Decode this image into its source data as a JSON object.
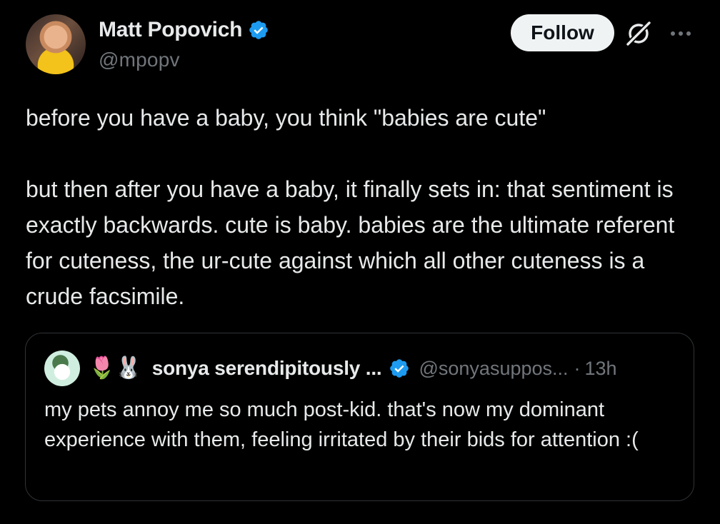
{
  "author": {
    "display_name": "Matt Popovich",
    "handle": "@mpopv",
    "verified": true
  },
  "actions": {
    "follow_label": "Follow"
  },
  "tweet": {
    "paragraph_1": "before you have a baby, you think \"babies are cute\"",
    "paragraph_2": "but then after you have a baby, it finally sets in: that sentiment is exactly backwards. cute is baby. babies are the ultimate referent for cuteness, the ur-cute against which all other cuteness is a crude facsimile."
  },
  "quoted_tweet": {
    "emojis": "🌷🐰",
    "display_name": "sonya serendipitously ...",
    "handle": "@sonyasuppos...",
    "separator": "·",
    "time": "13h",
    "verified": true,
    "text": "my pets annoy me so much post-kid. that's now my dominant experience with them, feeling irritated by their bids for attention :("
  },
  "colors": {
    "background": "#000000",
    "text_primary": "#e7e9ea",
    "text_secondary": "#71767b",
    "verified_blue": "#1d9bf0",
    "border": "#2f3336"
  },
  "icons": {
    "verified": "verified-badge-icon",
    "grok": "grok-icon",
    "more": "more-options-icon"
  }
}
